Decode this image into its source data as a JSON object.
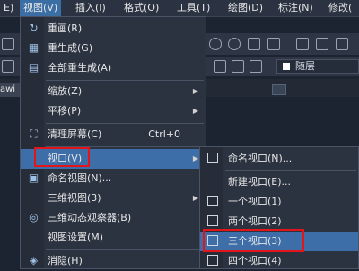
{
  "menubar": {
    "items": [
      {
        "label": "E)"
      },
      {
        "label": "视图(V)"
      },
      {
        "label": "插入(I)"
      },
      {
        "label": "格式(O)"
      },
      {
        "label": "工具(T)"
      },
      {
        "label": "绘图(D)"
      },
      {
        "label": "标注(N)"
      },
      {
        "label": "修改("
      }
    ]
  },
  "toolbar": {
    "layer_combo_text": "随层"
  },
  "tabs": {
    "doc_tab": "awi"
  },
  "view_menu": {
    "items": [
      {
        "label": "重画(R)",
        "icon": "redraw-icon"
      },
      {
        "label": "重生成(G)",
        "icon": "regen-icon"
      },
      {
        "label": "全部重生成(A)",
        "icon": "regen-all-icon"
      },
      {
        "label": "缩放(Z)"
      },
      {
        "label": "平移(P)"
      },
      {
        "label": "清理屏幕(C)",
        "shortcut": "Ctrl+0",
        "icon": "clean-screen-icon"
      },
      {
        "label": "视口(V)"
      },
      {
        "label": "命名视图(N)...",
        "icon": "named-view-icon"
      },
      {
        "label": "三维视图(3)"
      },
      {
        "label": "三维动态观察器(B)",
        "icon": "orbit-icon"
      },
      {
        "label": "视图设置(M)"
      },
      {
        "label": "消隐(H)",
        "icon": "hide-icon"
      }
    ]
  },
  "viewport_submenu": {
    "items": [
      {
        "label": "命名视口(N)...",
        "icon": "named-viewport-icon"
      },
      {
        "label": "新建视口(E)..."
      },
      {
        "label": "一个视口(1)",
        "icon": "one-viewport-icon"
      },
      {
        "label": "两个视口(2)",
        "icon": "two-viewports-icon"
      },
      {
        "label": "三个视口(3)",
        "icon": "three-viewports-icon"
      },
      {
        "label": "四个视口(4)",
        "icon": "four-viewports-icon"
      }
    ]
  },
  "colors": {
    "highlight": "#3d6ea8",
    "callout": "#e3141a"
  }
}
